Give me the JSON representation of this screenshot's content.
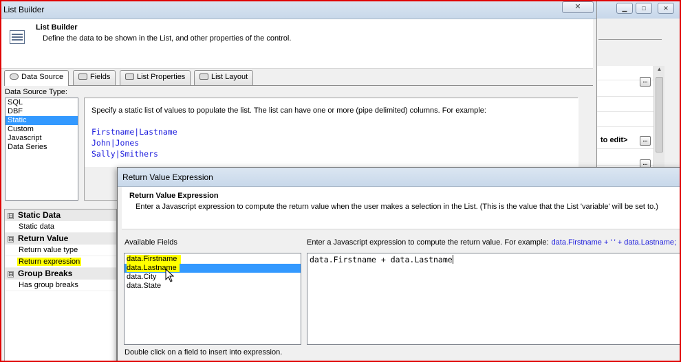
{
  "list_builder": {
    "title": "List Builder",
    "close_glyph": "✕",
    "header_title": "List Builder",
    "header_desc": "Define the data to be shown in the List, and other properties of the control.",
    "tabs": [
      "Data Source",
      "Fields",
      "List Properties",
      "List Layout"
    ],
    "data_source_type_label": "Data Source Type:",
    "data_source_types": [
      "SQL",
      "DBF",
      "Static",
      "Custom",
      "Javascript",
      "Data Series"
    ],
    "selected_type": "Static",
    "static_instructions": "Specify a static list of values to populate the list. The list can have one or more (pipe delimited) columns. For example:",
    "static_example": [
      "Firstname|Lastname",
      "John|Jones",
      "Sally|Smithers"
    ]
  },
  "properties": {
    "categories": [
      {
        "label": "Static Data",
        "toggle": "⊟",
        "rows": [
          {
            "label": "Static data"
          }
        ]
      },
      {
        "label": "Return Value",
        "toggle": "⊟",
        "rows": [
          {
            "label": "Return value type"
          },
          {
            "label": "Return expression",
            "highlight": true
          }
        ]
      },
      {
        "label": "Group Breaks",
        "toggle": "⊟",
        "rows": [
          {
            "label": "Has group breaks"
          }
        ]
      }
    ]
  },
  "background_window": {
    "edit_text": "to edit>",
    "ellipsis": "..."
  },
  "return_value_dialog": {
    "title": "Return Value Expression",
    "header_title": "Return Value Expression",
    "header_desc": "Enter a Javascript expression to compute the return value when the user makes a selection in the List. (This is the value that the List 'variable' will be set to.)",
    "available_fields_label": "Available Fields",
    "expression_label": "Enter a Javascript expression to compute the return value. For example:",
    "expression_example": "data.Firstname + ' ' + data.Lastname;",
    "fields": [
      "data.Firstname",
      "data.Lastname",
      "data.City",
      "data.State"
    ],
    "selected_field": "data.Lastname",
    "expression_value": "data.Firstname + data.Lastname",
    "footer_hint": "Double click on a field to insert into expression."
  },
  "colors": {
    "highlight": "#ffff00",
    "selection": "#3399ff",
    "code_blue": "#1a1adc",
    "frame_red": "#e00000"
  }
}
